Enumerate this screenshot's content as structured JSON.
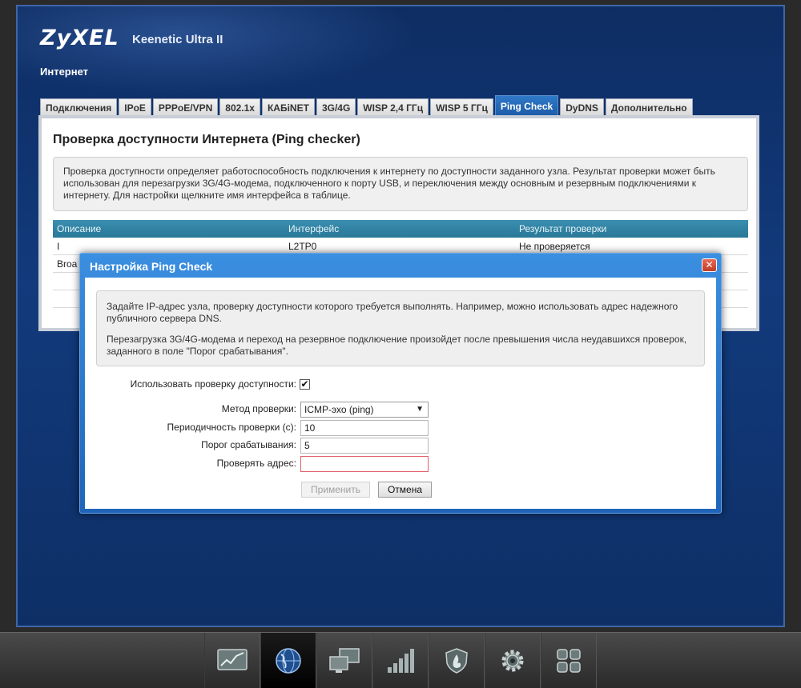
{
  "header": {
    "logo": "ZyXEL",
    "model": "Keenetic Ultra II",
    "section": "Интернет"
  },
  "tabs": [
    {
      "label": "Подключения"
    },
    {
      "label": "IPoE"
    },
    {
      "label": "PPPoE/VPN"
    },
    {
      "label": "802.1x"
    },
    {
      "label": "КАБiNET"
    },
    {
      "label": "3G/4G"
    },
    {
      "label": "WISP 2,4 ГГц"
    },
    {
      "label": "WISP 5 ГГц"
    },
    {
      "label": "Ping Check",
      "active": true
    },
    {
      "label": "DyDNS"
    },
    {
      "label": "Дополнительно"
    }
  ],
  "panel": {
    "title": "Проверка доступности Интернета (Ping checker)",
    "description": "Проверка доступности определяет работоспособность подключения к интернету по доступности заданного узла. Результат проверки может быть использован для перезагрузки 3G/4G-модема, подключенного к порту USB, и переключения между основным и резервным подключениями к интернету. Для настройки щелкните имя интерфейса в таблице.",
    "table": {
      "headers": [
        "Описание",
        "Интерфейс",
        "Результат проверки"
      ],
      "rows": [
        [
          "I",
          "L2TP0",
          "Не проверяется"
        ],
        [
          "Broa",
          "",
          ""
        ],
        [
          "",
          "",
          ""
        ],
        [
          "",
          "",
          ""
        ]
      ]
    }
  },
  "dialog": {
    "title": "Настройка Ping Check",
    "hint_1": "Задайте IP-адрес узла, проверку доступности которого требуется выполнять. Например, можно использовать адрес надежного публичного сервера DNS.",
    "hint_2": "Перезагрузка 3G/4G-модема и переход на резервное подключение произойдет после превышения числа неудавшихся проверок, заданного в поле \"Порог срабатывания\".",
    "use_check_label": "Использовать проверку доступности:",
    "use_check_value": true,
    "method_label": "Метод проверки:",
    "method_value": "ICMP-эхо (ping)",
    "period_label": "Периодичность проверки (с):",
    "period_value": "10",
    "threshold_label": "Порог срабатывания:",
    "threshold_value": "5",
    "address_label": "Проверять адрес:",
    "address_value": "",
    "apply_label": "Применить",
    "cancel_label": "Отмена"
  },
  "taskbar": {
    "items": [
      "monitor-icon",
      "internet-globe-icon",
      "home-network-icon",
      "wifi-signal-icon",
      "security-shield-icon",
      "system-gear-icon",
      "apps-grid-icon"
    ],
    "active": "internet-globe-icon"
  }
}
